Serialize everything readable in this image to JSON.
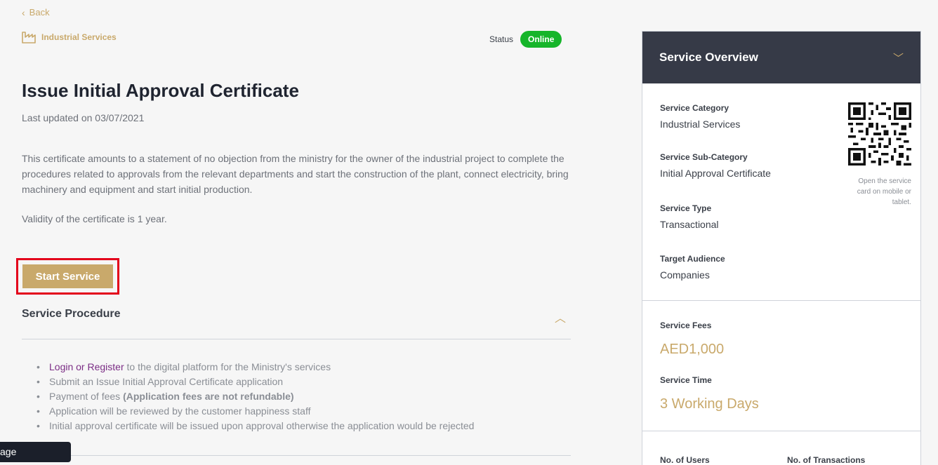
{
  "nav": {
    "back_label": "Back"
  },
  "category": {
    "label": "Industrial Services"
  },
  "status": {
    "label": "Status",
    "value": "Online"
  },
  "service": {
    "title": "Issue Initial Approval Certificate",
    "updated": "Last updated on 03/07/2021",
    "description": "This certificate amounts to a statement of no objection from the ministry for the owner of the industrial project to complete the procedures related to approvals from the relevant departments and start the construction of the plant, connect electricity, bring machinery and equipment and start initial production.",
    "validity": "Validity of the certificate is 1 year.",
    "start_label": "Start Service"
  },
  "procedure": {
    "title": "Service Procedure",
    "steps": [
      {
        "link": "Login or Register",
        "text": " to the digital platform for the Ministry's services"
      },
      {
        "text": "Submit an Issue Initial Approval Certificate application"
      },
      {
        "text": "Payment of fees ",
        "bold": "(Application fees are not refundable)"
      },
      {
        "text": "Application will be reviewed by the customer happiness staff"
      },
      {
        "text": "Initial approval certificate will be issued upon approval otherwise the application would be rejected"
      }
    ]
  },
  "tooltip": {
    "text": "age"
  },
  "overview": {
    "title": "Service Overview",
    "fields": [
      {
        "label": "Service Category",
        "value": "Industrial Services"
      },
      {
        "label": "Service Sub-Category",
        "value": "Initial Approval Certificate"
      },
      {
        "label": "Service Type",
        "value": "Transactional"
      },
      {
        "label": "Target Audience",
        "value": "Companies"
      }
    ],
    "qr_note": "Open the service card on mobile or tablet.",
    "fees_label": "Service Fees",
    "fees_value": "AED1,000",
    "time_label": "Service Time",
    "time_value": "3 Working Days",
    "users_label": "No. of Users",
    "transactions_label": "No. of Transactions"
  },
  "colors": {
    "accent": "#c9a96b",
    "header": "#363a47",
    "online": "#16b52a",
    "highlight": "#e3001b",
    "link": "#7b2d85"
  }
}
